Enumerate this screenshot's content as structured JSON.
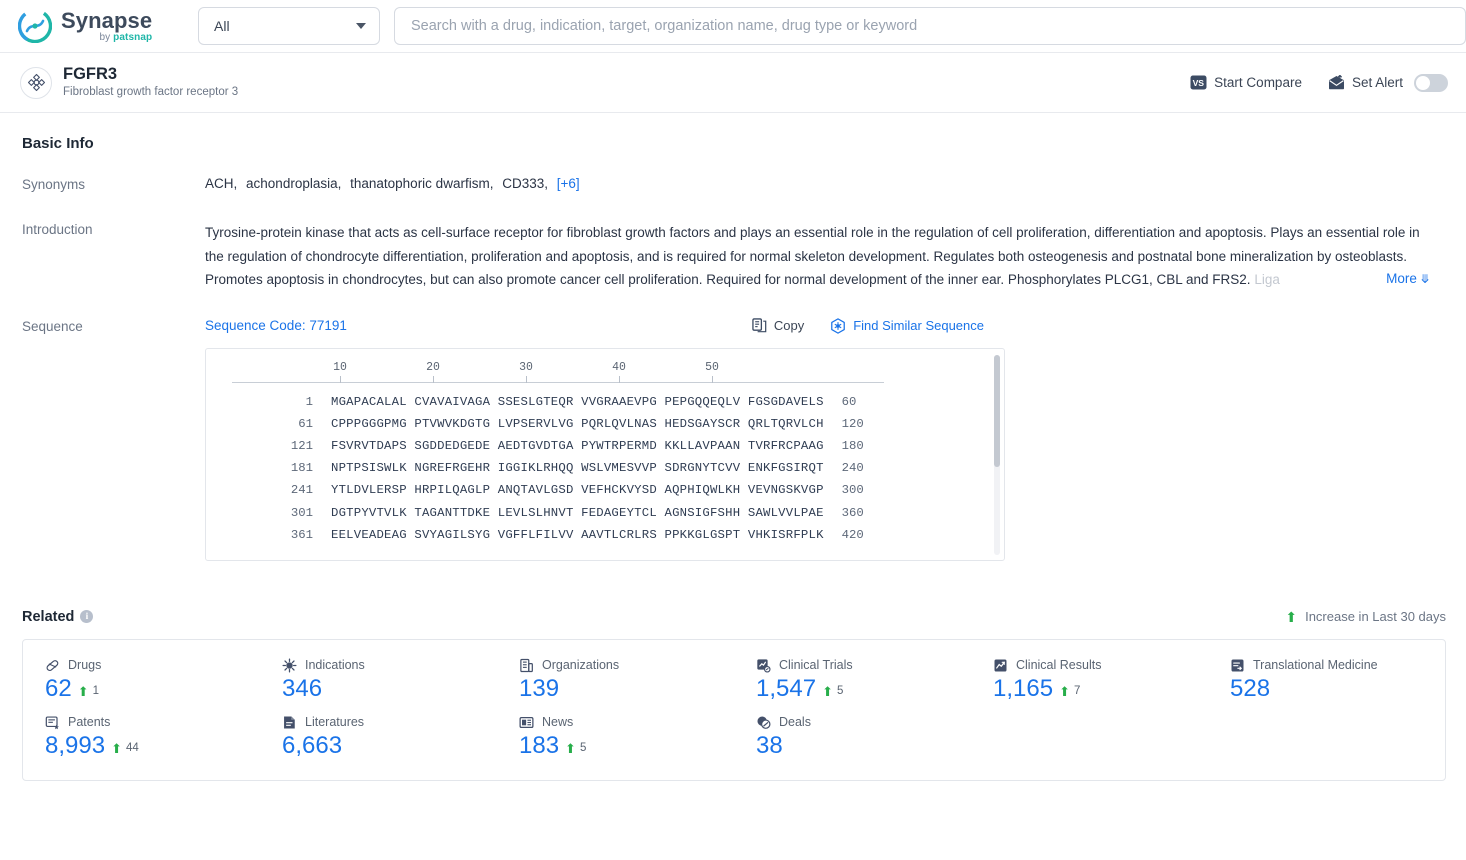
{
  "topbar": {
    "logo_title": "Synapse",
    "logo_by": "by ",
    "logo_brand": "patsnap",
    "category_value": "All",
    "search_placeholder": "Search with a drug, indication, target, organization name, drug type or keyword",
    "search_value": ""
  },
  "entity": {
    "title": "FGFR3",
    "subtitle": "Fibroblast growth factor receptor 3",
    "start_compare_label": "Start Compare",
    "set_alert_label": "Set Alert",
    "alert_enabled": false
  },
  "basic_info": {
    "section_title": "Basic Info",
    "synonyms_label": "Synonyms",
    "synonyms": [
      "ACH,",
      "achondroplasia,",
      "thanatophoric dwarfism,",
      "CD333,"
    ],
    "synonyms_more": "[+6]",
    "introduction_label": "Introduction",
    "introduction_text": "Tyrosine-protein kinase that acts as cell-surface receptor for fibroblast growth factors and plays an essential role in the regulation of cell proliferation, differentiation and apoptosis. Plays an essential role in the regulation of chondrocyte differentiation, proliferation and apoptosis, and is required for normal skeleton development. Regulates both osteogenesis and postnatal bone mineralization by osteoblasts. Promotes apoptosis in chondrocytes, but can also promote cancer cell proliferation. Required for normal development of the inner ear. Phosphorylates PLCG1, CBL and FRS2. ",
    "introduction_truncated_tail": "Liga",
    "more_label": "More",
    "sequence_label": "Sequence",
    "sequence_code": "Sequence Code: 77191",
    "copy_label": "Copy",
    "find_similar_label": "Find Similar Sequence"
  },
  "sequence": {
    "ruler_ticks": [
      10,
      20,
      30,
      40,
      50
    ],
    "rows": [
      {
        "start": "1",
        "chunks": "MGAPACALAL CVAVAIVAGA SSESLGTEQR VVGRAAEVPG PEPGQQEQLV FGSGDAVELS",
        "end": "60"
      },
      {
        "start": "61",
        "chunks": "CPPPGGGPMG PTVWVKDGTG LVPSERVLVG PQRLQVLNAS HEDSGAYSCR QRLTQRVLCH",
        "end": "120"
      },
      {
        "start": "121",
        "chunks": "FSVRVTDAPS SGDDEDGEDE AEDTGVDTGA PYWTRPERMD KKLLAVPAAN TVRFRCPAAG",
        "end": "180"
      },
      {
        "start": "181",
        "chunks": "NPTPSISWLK NGREFRGEHR IGGIKLRHQQ WSLVMESVVP SDRGNYTCVV ENKFGSIRQT",
        "end": "240"
      },
      {
        "start": "241",
        "chunks": "YTLDVLERSP HRPILQAGLP ANQTAVLGSD VEFHCKVYSD AQPHIQWLKH VEVNGSKVGP",
        "end": "300"
      },
      {
        "start": "301",
        "chunks": "DGTPYVTVLK TAGANTTDKE LEVLSLHNVT FEDAGEYTCL AGNSIGFSHH SAWLVVLPAE",
        "end": "360"
      },
      {
        "start": "361",
        "chunks": "EELVEADEAG SVYAGILSYG VGFFLFILVV AAVTLCRLRS PPKKGLGSPT VHKISRFPLK",
        "end": "420"
      }
    ]
  },
  "related": {
    "title": "Related",
    "increase_note": "Increase in Last 30 days",
    "items": [
      {
        "icon": "pill-icon",
        "label": "Drugs",
        "value": "62",
        "delta": "1"
      },
      {
        "icon": "virus-icon",
        "label": "Indications",
        "value": "346",
        "delta": ""
      },
      {
        "icon": "building-icon",
        "label": "Organizations",
        "value": "139",
        "delta": ""
      },
      {
        "icon": "clinical-trial-icon",
        "label": "Clinical Trials",
        "value": "1,547",
        "delta": "5"
      },
      {
        "icon": "clinical-result-icon",
        "label": "Clinical Results",
        "value": "1,165",
        "delta": "7"
      },
      {
        "icon": "translational-icon",
        "label": "Translational Medicine",
        "value": "528",
        "delta": ""
      },
      {
        "icon": "patent-icon",
        "label": "Patents",
        "value": "8,993",
        "delta": "44"
      },
      {
        "icon": "literature-icon",
        "label": "Literatures",
        "value": "6,663",
        "delta": ""
      },
      {
        "icon": "news-icon",
        "label": "News",
        "value": "183",
        "delta": "5"
      },
      {
        "icon": "deals-icon",
        "label": "Deals",
        "value": "38",
        "delta": ""
      }
    ]
  },
  "colors": {
    "accent_blue": "#1a73e8",
    "increase_green": "#27ae4a",
    "text_dark": "#1e2835",
    "text_muted": "#6b7585"
  }
}
